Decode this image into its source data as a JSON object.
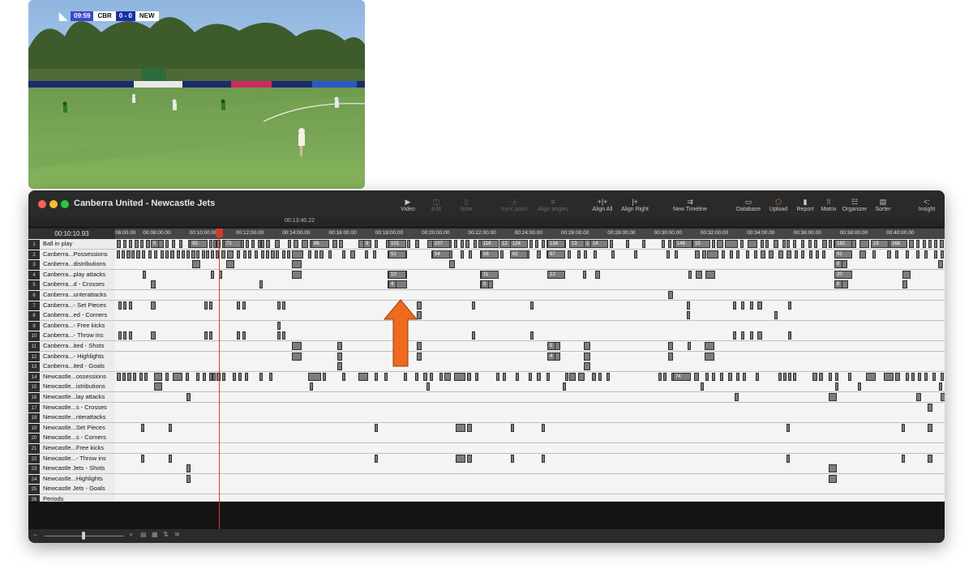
{
  "video": {
    "scorebug": {
      "time": "09:59",
      "team1": "CBR",
      "score": "0 - 0",
      "team2": "NEW"
    }
  },
  "window": {
    "title": "Canberra United - Newcastle Jets",
    "current_time": "00:13:40.22",
    "timecode": "00:10:10.93"
  },
  "toolbar": [
    {
      "label": "Video",
      "icon": "video-icon",
      "enabled": true
    },
    {
      "label": "Edit",
      "icon": "edit-icon",
      "enabled": false
    },
    {
      "label": "Note",
      "icon": "note-icon",
      "enabled": false
    },
    {
      "label": "Sync point",
      "icon": "sync-point-icon",
      "enabled": false
    },
    {
      "label": "Align angles",
      "icon": "align-angles-icon",
      "enabled": false
    },
    {
      "label": "Align All",
      "icon": "align-all-icon",
      "enabled": true
    },
    {
      "label": "Align Right",
      "icon": "align-right-icon",
      "enabled": true
    },
    {
      "label": "New Timeline",
      "icon": "new-timeline-icon",
      "enabled": true
    },
    {
      "label": "Database",
      "icon": "database-icon",
      "enabled": true
    },
    {
      "label": "Upload",
      "icon": "upload-icon",
      "enabled": true
    },
    {
      "label": "Report",
      "icon": "report-icon",
      "enabled": true
    },
    {
      "label": "Matrix",
      "icon": "matrix-icon",
      "enabled": true
    },
    {
      "label": "Organizer",
      "icon": "organizer-icon",
      "enabled": true
    },
    {
      "label": "Sorter",
      "icon": "sorter-icon",
      "enabled": true
    },
    {
      "label": "Insight",
      "icon": "insight-icon",
      "enabled": true
    }
  ],
  "ruler_ticks": [
    "06:00.00",
    "00:08:00.00",
    "00:10:00.00",
    "00:12:00.00",
    "00:14:00.00",
    "00:16:00.00",
    "00:18:00.00",
    "00:20:00.00",
    "00:22:00.00",
    "00:24:00.00",
    "00:26:00.00",
    "00:28:00.00",
    "00:30:00.00",
    "00:32:00.00",
    "00:34:00.00",
    "00:36:00.00",
    "00:38:00.00",
    "00:40:00.00"
  ],
  "rows": [
    {
      "num": "1",
      "label": "Ball in play"
    },
    {
      "num": "2",
      "label": "Canberra...Possessions"
    },
    {
      "num": "3",
      "label": "Canberra...distributions"
    },
    {
      "num": "4",
      "label": "Canberra...play attacks"
    },
    {
      "num": "5",
      "label": "Canberra...d - Crosses"
    },
    {
      "num": "6",
      "label": "Canberra...unterattacks"
    },
    {
      "num": "7",
      "label": "Canberra...- Set Pieces"
    },
    {
      "num": "8",
      "label": "Canberra...ed - Corners"
    },
    {
      "num": "9",
      "label": "Canberra...- Free kicks"
    },
    {
      "num": "10",
      "label": "Canberra...- Throw ins"
    },
    {
      "num": "11",
      "label": "Canberra...ited - Shots"
    },
    {
      "num": "12",
      "label": "Canberra...- Highlights"
    },
    {
      "num": "13",
      "label": "Canberra...ited - Goals"
    },
    {
      "num": "14",
      "label": "Newcastle...ossessions"
    },
    {
      "num": "15",
      "label": "Newcastle...istributions"
    },
    {
      "num": "16",
      "label": "Newcastle...lay attacks"
    },
    {
      "num": "17",
      "label": "Newcastle...s - Crosses"
    },
    {
      "num": "18",
      "label": "Newcastle...nterattacks"
    },
    {
      "num": "19",
      "label": "Newcastle...Set Pieces"
    },
    {
      "num": "20",
      "label": "Newcastle...s - Corners"
    },
    {
      "num": "21",
      "label": "Newcastle...Free kicks"
    },
    {
      "num": "22",
      "label": "Newcastle...- Throw ins"
    },
    {
      "num": "23",
      "label": "Newcastle Jets - Shots"
    },
    {
      "num": "24",
      "label": "Newcastle...Highlights"
    },
    {
      "num": "25",
      "label": "Newcastle Jets - Goals"
    },
    {
      "num": "26",
      "label": "Periods"
    }
  ],
  "segment_labels": {
    "1": [
      [
        "5",
        44
      ],
      [
        "55",
        92
      ],
      [
        "71",
        134
      ],
      [
        "86",
        242
      ],
      [
        "9",
        306
      ],
      [
        "101",
        337
      ],
      [
        "107",
        391
      ],
      [
        "116",
        451
      ],
      [
        "12",
        474
      ],
      [
        "124",
        487
      ],
      [
        "134",
        533
      ],
      [
        "13",
        560
      ],
      [
        "1",
        578
      ],
      [
        "14",
        586
      ],
      [
        "146",
        690
      ],
      [
        "15",
        712
      ],
      [
        "182",
        887
      ],
      [
        "18",
        932
      ],
      [
        "168",
        955
      ]
    ],
    "2": [
      [
        "51",
        337
      ],
      [
        "54",
        391
      ],
      [
        "58",
        451
      ],
      [
        "62",
        487
      ],
      [
        "67",
        533
      ],
      [
        "91",
        887
      ]
    ],
    "3": [
      [
        "8",
        887
      ]
    ],
    "4": [
      [
        "10",
        337
      ],
      [
        "11",
        451
      ],
      [
        "12",
        533
      ],
      [
        "20",
        887
      ]
    ],
    "5": [
      [
        "4",
        337
      ],
      [
        "5",
        451
      ],
      [
        "8",
        887
      ]
    ],
    "11": [
      [
        "5",
        533
      ]
    ],
    "12": [
      [
        "4",
        533
      ]
    ],
    "14": [
      [
        "74",
        688
      ]
    ]
  },
  "footer": {
    "zoom_out_icon": "minus-icon",
    "zoom_in_icon": "plus-icon"
  }
}
